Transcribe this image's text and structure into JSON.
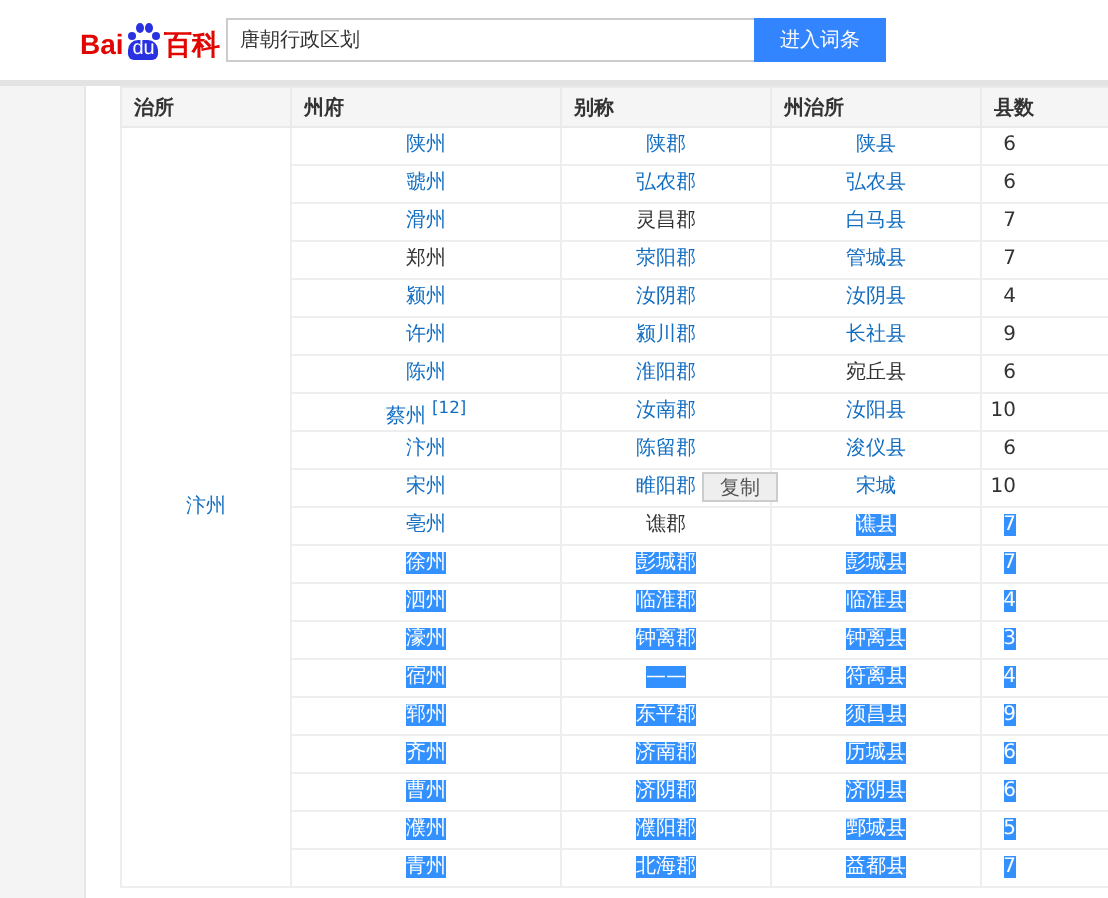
{
  "header": {
    "logo": {
      "left": "Bai",
      "paw": "du",
      "right": "百科"
    },
    "search": {
      "value": "唐朝行政区划"
    },
    "button": "进入词条"
  },
  "table": {
    "columns": [
      "治所",
      "州府",
      "别称",
      "州治所",
      "县数"
    ],
    "rows": [
      {
        "cells": [
          {
            "text": "汴州",
            "link": true,
            "selected": false,
            "rowspan": 20
          },
          {
            "text": "陕州",
            "link": true,
            "selected": false
          },
          {
            "text": "陕郡",
            "link": true,
            "selected": false
          },
          {
            "text": "陕县",
            "link": true,
            "selected": false
          },
          {
            "text": "6",
            "link": false,
            "selected": false
          }
        ]
      },
      {
        "cells": [
          {
            "text": "虢州",
            "link": true,
            "selected": false
          },
          {
            "text": "弘农郡",
            "link": true,
            "selected": false
          },
          {
            "text": "弘农县",
            "link": true,
            "selected": false
          },
          {
            "text": "6",
            "link": false,
            "selected": false
          }
        ]
      },
      {
        "cells": [
          {
            "text": "滑州",
            "link": true,
            "selected": false
          },
          {
            "text": "灵昌郡",
            "link": false,
            "selected": false
          },
          {
            "text": "白马县",
            "link": true,
            "selected": false
          },
          {
            "text": "7",
            "link": false,
            "selected": false
          }
        ]
      },
      {
        "cells": [
          {
            "text": "郑州",
            "link": false,
            "selected": false
          },
          {
            "text": "荥阳郡",
            "link": true,
            "selected": false
          },
          {
            "text": "管城县",
            "link": true,
            "selected": false
          },
          {
            "text": "7",
            "link": false,
            "selected": false
          }
        ]
      },
      {
        "cells": [
          {
            "text": "颍州",
            "link": true,
            "selected": false
          },
          {
            "text": "汝阴郡",
            "link": true,
            "selected": false
          },
          {
            "text": "汝阴县",
            "link": true,
            "selected": false
          },
          {
            "text": "4",
            "link": false,
            "selected": false
          }
        ]
      },
      {
        "cells": [
          {
            "text": "许州",
            "link": true,
            "selected": false
          },
          {
            "text": "颍川郡",
            "link": true,
            "selected": false
          },
          {
            "text": "长社县",
            "link": true,
            "selected": false
          },
          {
            "text": "9",
            "link": false,
            "selected": false
          }
        ]
      },
      {
        "cells": [
          {
            "text": "陈州",
            "link": true,
            "selected": false
          },
          {
            "text": "淮阳郡",
            "link": true,
            "selected": false
          },
          {
            "text": "宛丘县",
            "link": false,
            "selected": false
          },
          {
            "text": "6",
            "link": false,
            "selected": false
          }
        ]
      },
      {
        "cells": [
          {
            "text": "蔡州 $^{[12]}$",
            "link": true,
            "selected": false
          },
          {
            "text": "汝南郡",
            "link": true,
            "selected": false
          },
          {
            "text": "汝阳县",
            "link": true,
            "selected": false
          },
          {
            "text": "10",
            "link": false,
            "selected": false
          }
        ]
      },
      {
        "cells": [
          {
            "text": "汴州",
            "link": true,
            "selected": false
          },
          {
            "text": "陈留郡",
            "link": true,
            "selected": false
          },
          {
            "text": "浚仪县",
            "link": true,
            "selected": false
          },
          {
            "text": "6",
            "link": false,
            "selected": false
          }
        ]
      },
      {
        "cells": [
          {
            "text": "宋州",
            "link": true,
            "selected": false
          },
          {
            "text": "睢阳郡",
            "link": true,
            "selected": false
          },
          {
            "text": "宋城",
            "link": true,
            "selected": false
          },
          {
            "text": "10",
            "link": false,
            "selected": false
          }
        ],
        "copy_button": "复制"
      },
      {
        "cells": [
          {
            "text": "亳州",
            "link": true,
            "selected": false
          },
          {
            "text": "谯郡",
            "link": false,
            "selected": false
          },
          {
            "text": "谯县",
            "selected": true
          },
          {
            "text": "7",
            "selected": true
          }
        ]
      },
      {
        "cells": [
          {
            "text": "徐州",
            "selected": true
          },
          {
            "text": "彭城郡",
            "selected": true
          },
          {
            "text": "彭城县",
            "selected": true
          },
          {
            "text": "7",
            "selected": true
          }
        ]
      },
      {
        "cells": [
          {
            "text": "泗州",
            "selected": true
          },
          {
            "text": "临淮郡",
            "selected": true
          },
          {
            "text": "临淮县",
            "selected": true
          },
          {
            "text": "4",
            "selected": true
          }
        ]
      },
      {
        "cells": [
          {
            "text": "濠州",
            "selected": true
          },
          {
            "text": "钟离郡",
            "selected": true
          },
          {
            "text": "钟离县",
            "selected": true
          },
          {
            "text": "3",
            "selected": true
          }
        ]
      },
      {
        "cells": [
          {
            "text": "宿州",
            "selected": true
          },
          {
            "text": "——",
            "selected": true
          },
          {
            "text": "符离县",
            "selected": true
          },
          {
            "text": "4",
            "selected": true
          }
        ]
      },
      {
        "cells": [
          {
            "text": "郓州",
            "selected": true
          },
          {
            "text": "东平郡",
            "selected": true
          },
          {
            "text": "须昌县",
            "selected": true
          },
          {
            "text": "9",
            "selected": true
          }
        ]
      },
      {
        "cells": [
          {
            "text": "齐州",
            "selected": true
          },
          {
            "text": "济南郡",
            "selected": true
          },
          {
            "text": "历城县",
            "selected": true
          },
          {
            "text": "6",
            "selected": true
          }
        ]
      },
      {
        "cells": [
          {
            "text": "曹州",
            "selected": true
          },
          {
            "text": "济阴郡",
            "selected": true
          },
          {
            "text": "济阴县",
            "selected": true
          },
          {
            "text": "6",
            "selected": true
          }
        ]
      },
      {
        "cells": [
          {
            "text": "濮州",
            "selected": true
          },
          {
            "text": "濮阳郡",
            "selected": true
          },
          {
            "text": "鄄城县",
            "selected": true
          },
          {
            "text": "5",
            "selected": true
          }
        ]
      },
      {
        "cells": [
          {
            "text": "青州",
            "selected": true
          },
          {
            "text": "北海郡",
            "selected": true
          },
          {
            "text": "益都县",
            "selected": true
          },
          {
            "text": "7",
            "selected": true
          }
        ]
      }
    ]
  }
}
